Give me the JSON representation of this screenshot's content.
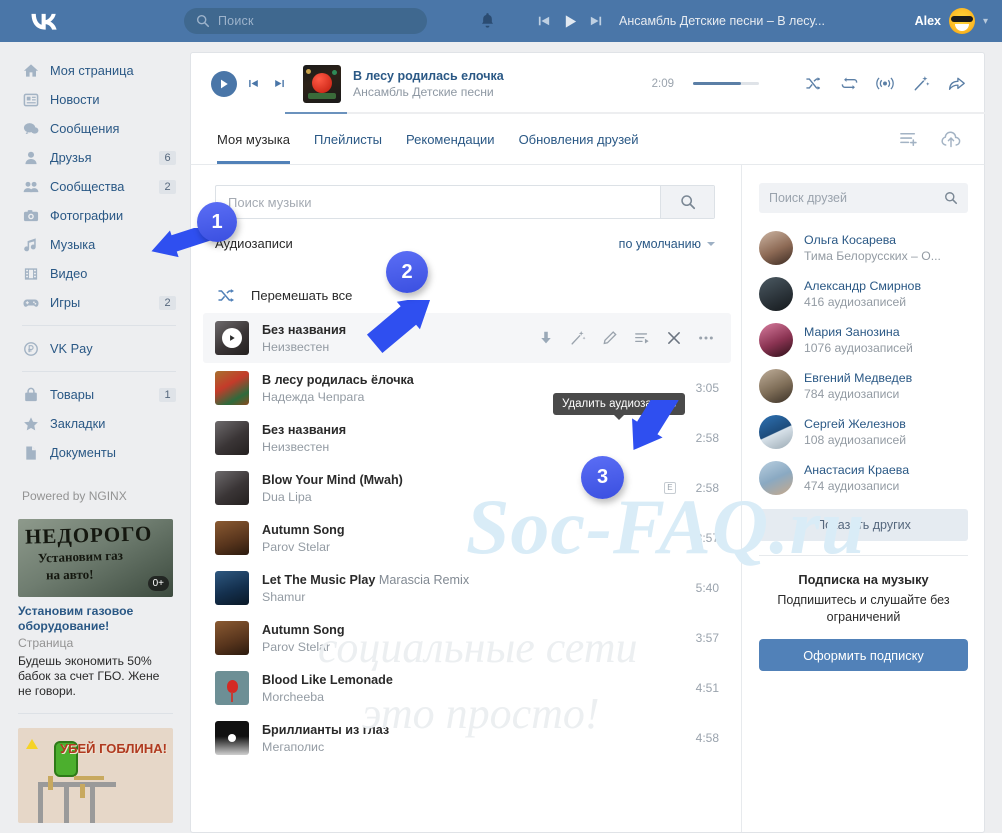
{
  "topbar": {
    "logo_icon": "vk-logo-icon",
    "search_placeholder": "Поиск",
    "search_icon": "search-icon",
    "bell_icon": "bell-icon",
    "mini_player": {
      "prev_icon": "previous-track-icon",
      "play_icon": "play-icon",
      "next_icon": "next-track-icon",
      "now_playing": "Ансамбль Детские песни – В лесу..."
    },
    "account_name": "Alex",
    "avatar_icon": "user-avatar",
    "chevron_icon": "chevron-down-icon"
  },
  "sidebar": {
    "items": [
      {
        "label": "Моя страница",
        "icon": "home-icon",
        "count": ""
      },
      {
        "label": "Новости",
        "icon": "news-icon",
        "count": ""
      },
      {
        "label": "Сообщения",
        "icon": "messages-icon",
        "count": ""
      },
      {
        "label": "Друзья",
        "icon": "friends-icon",
        "count": "6"
      },
      {
        "label": "Сообщества",
        "icon": "groups-icon",
        "count": "2"
      },
      {
        "label": "Фотографии",
        "icon": "camera-icon",
        "count": ""
      },
      {
        "label": "Музыка",
        "icon": "music-note-icon",
        "count": ""
      },
      {
        "label": "Видео",
        "icon": "video-icon",
        "count": ""
      },
      {
        "label": "Игры",
        "icon": "gamepad-icon",
        "count": "2"
      }
    ],
    "pay": {
      "label": "VK Pay",
      "icon": "ruble-icon"
    },
    "items2": [
      {
        "label": "Товары",
        "icon": "bag-icon",
        "count": "1"
      },
      {
        "label": "Закладки",
        "icon": "star-icon",
        "count": ""
      },
      {
        "label": "Документы",
        "icon": "document-icon",
        "count": ""
      }
    ],
    "powered_by": "Powered by NGINX",
    "ad1": {
      "image_text_1": "НЕДОРОГО",
      "image_text_2": "Установим газ",
      "image_text_3": "на авто!",
      "age_badge": "0+",
      "title": "Установим газовое оборудование!",
      "subtitle": "Страница",
      "text": "Будешь экономить 50% бабок за счет ГБО. Жене не говори."
    },
    "ad2": {
      "image_text": "УБЕЙ ГОБЛИНА!"
    }
  },
  "player": {
    "play_icon": "play-icon",
    "prev_icon": "previous-track-icon",
    "next_icon": "next-track-icon",
    "title": "В лесу родилась елочка",
    "artist": "Ансамбль Детские песни",
    "time": "2:09",
    "icons": [
      {
        "name": "shuffle-icon"
      },
      {
        "name": "repeat-icon"
      },
      {
        "name": "broadcast-icon"
      },
      {
        "name": "magic-wand-icon"
      },
      {
        "name": "share-icon"
      }
    ]
  },
  "tabs": {
    "items": [
      {
        "label": "Моя музыка",
        "active": true
      },
      {
        "label": "Плейлисты",
        "active": false
      },
      {
        "label": "Рекомендации",
        "active": false
      },
      {
        "label": "Обновления друзей",
        "active": false
      }
    ],
    "icons": [
      {
        "name": "add-to-playlist-icon"
      },
      {
        "name": "upload-cloud-icon"
      }
    ]
  },
  "music_search": {
    "placeholder": "Поиск музыки",
    "value": "",
    "button_icon": "search-icon"
  },
  "audio_section": {
    "title": "Аудиозаписи",
    "sort_label": "по умолчанию",
    "sort_icon": "chevron-down-icon",
    "shuffle_label": "Перемешать все",
    "shuffle_icon": "shuffle-icon"
  },
  "row_actions": {
    "tooltip": "Удалить аудиозапись",
    "icons": [
      {
        "name": "download-icon"
      },
      {
        "name": "magic-wand-icon"
      },
      {
        "name": "edit-pencil-icon"
      },
      {
        "name": "add-to-playlist-icon"
      },
      {
        "name": "delete-x-icon"
      },
      {
        "name": "more-dots-icon"
      }
    ]
  },
  "tracks": [
    {
      "title": "Без названия",
      "remix": "",
      "artist": "Неизвестен",
      "duration": "",
      "explicit": false,
      "hovered": true,
      "cover": "portrait-dark"
    },
    {
      "title": "В лесу родилась ёлочка",
      "remix": "",
      "artist": "Надежда Чепрага",
      "duration": "3:05",
      "explicit": false,
      "hovered": false,
      "cover": "santa"
    },
    {
      "title": "Без названия",
      "remix": "",
      "artist": "Неизвестен",
      "duration": "2:58",
      "explicit": false,
      "hovered": false,
      "cover": "portrait-dark"
    },
    {
      "title": "Blow Your Mind (Mwah)",
      "remix": "",
      "artist": "Dua Lipa",
      "duration": "2:58",
      "explicit": true,
      "hovered": false,
      "cover": "portrait-dark"
    },
    {
      "title": "Autumn Song",
      "remix": "",
      "artist": "Parov Stelar",
      "duration": "3:57",
      "explicit": false,
      "hovered": false,
      "cover": "brown"
    },
    {
      "title": "Let The Music Play ",
      "remix": "Marascia Remix",
      "artist": "Shamur",
      "duration": "5:40",
      "explicit": false,
      "hovered": false,
      "cover": "blue-sky"
    },
    {
      "title": "Autumn Song",
      "remix": "",
      "artist": "Parov Stelar",
      "duration": "3:57",
      "explicit": false,
      "hovered": false,
      "cover": "brown"
    },
    {
      "title": "Blood Like Lemonade",
      "remix": "",
      "artist": "Morcheeba",
      "duration": "4:51",
      "explicit": false,
      "hovered": false,
      "cover": "balloon"
    },
    {
      "title": "Бриллианты из глаз",
      "remix": "",
      "artist": "Мегаполис",
      "duration": "4:58",
      "explicit": false,
      "hovered": false,
      "cover": "bw-moon"
    }
  ],
  "friends_panel": {
    "search_placeholder": "Поиск друзей",
    "search_icon": "search-icon",
    "friends": [
      {
        "name": "Ольга Косарева",
        "sub": "Тима Белорусских – О...",
        "avatar": "avatar-olga"
      },
      {
        "name": "Александр Смирнов",
        "sub": "416 аудиозаписей",
        "avatar": "avatar-alexandr"
      },
      {
        "name": "Мария Занозина",
        "sub": "1076 аудиозаписей",
        "avatar": "avatar-maria"
      },
      {
        "name": "Евгений Медведев",
        "sub": "784 аудиозаписи",
        "avatar": "avatar-evgeniy"
      },
      {
        "name": "Сергей Железнов",
        "sub": "108 аудиозаписей",
        "avatar": "avatar-sergey"
      },
      {
        "name": "Анастасия Краева",
        "sub": "474 аудиозаписи",
        "avatar": "avatar-anastasia"
      }
    ],
    "show_more": "Показать других",
    "subscription": {
      "title": "Подписка на музыку",
      "desc": "Подпишитесь и слушайте без ограничений",
      "button": "Оформить подписку"
    }
  },
  "annotations": [
    {
      "number": "1"
    },
    {
      "number": "2"
    },
    {
      "number": "3"
    }
  ],
  "watermark": {
    "line1": "Soc-FAQ.ru",
    "line2": "социальные сети",
    "line3": "это просто!"
  },
  "colors": {
    "brand_blue": "#4a76a8",
    "accent_blue": "#5181b8",
    "link_blue": "#2a5885",
    "bg_gray": "#edeef0",
    "annotation_blue": "#3a4fe0"
  }
}
